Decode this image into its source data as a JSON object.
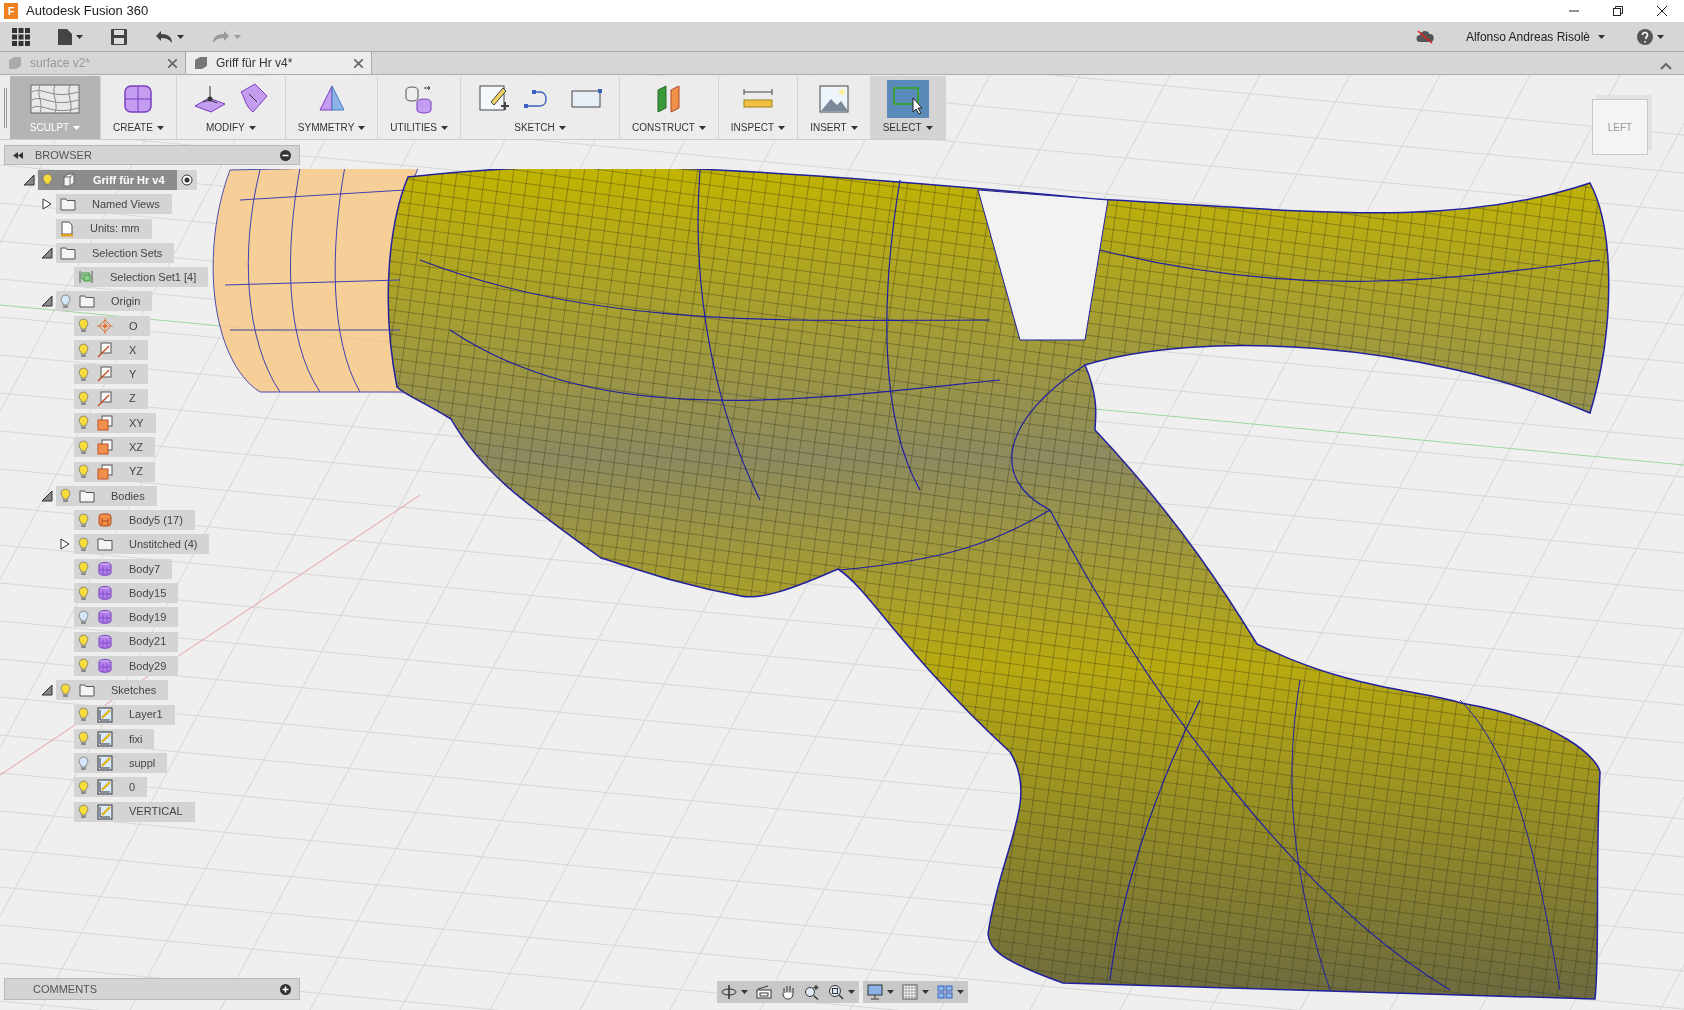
{
  "window": {
    "title": "Autodesk Fusion 360",
    "logo_letter": "F"
  },
  "user": {
    "name": "Alfonso Andreas Risolè"
  },
  "tabs": [
    {
      "label": "surface v2*",
      "selected": false
    },
    {
      "label": "Griff für Hr v4*",
      "selected": true
    }
  ],
  "toolbar": [
    {
      "kind": "sculpt",
      "label": "SCULPT",
      "highlighted": false
    },
    {
      "kind": "create",
      "label": "CREATE",
      "highlighted": false
    },
    {
      "kind": "modify",
      "label": "MODIFY",
      "highlighted": false
    },
    {
      "kind": "symmetry",
      "label": "SYMMETRY",
      "highlighted": false
    },
    {
      "kind": "utilities",
      "label": "UTILITIES",
      "highlighted": false
    },
    {
      "kind": "sketch",
      "label": "SKETCH",
      "highlighted": false
    },
    {
      "kind": "construct",
      "label": "CONSTRUCT",
      "highlighted": false
    },
    {
      "kind": "inspect",
      "label": "INSPECT",
      "highlighted": false
    },
    {
      "kind": "insert",
      "label": "INSERT",
      "highlighted": false
    },
    {
      "kind": "select",
      "label": "SELECT",
      "highlighted": true
    }
  ],
  "browser": {
    "title": "BROWSER",
    "tree": [
      {
        "kind": "component",
        "label": "Griff für Hr v4",
        "visible": true,
        "expanded": true,
        "children": [
          {
            "kind": "folder",
            "label": "Named Views",
            "expanded": false
          },
          {
            "kind": "units",
            "label": "Units: mm"
          },
          {
            "kind": "folder",
            "label": "Selection Sets",
            "expanded": true,
            "children": [
              {
                "kind": "selection-set",
                "label": "Selection Set1 [4]"
              }
            ]
          },
          {
            "kind": "folder",
            "label": "Origin",
            "visible": false,
            "expanded": true,
            "children": [
              {
                "kind": "point",
                "label": "O",
                "visible": true
              },
              {
                "kind": "axis",
                "label": "X",
                "visible": true
              },
              {
                "kind": "axis",
                "label": "Y",
                "visible": true
              },
              {
                "kind": "axis",
                "label": "Z",
                "visible": true
              },
              {
                "kind": "plane",
                "label": "XY",
                "visible": true
              },
              {
                "kind": "plane",
                "label": "XZ",
                "visible": true
              },
              {
                "kind": "plane",
                "label": "YZ",
                "visible": true
              }
            ]
          },
          {
            "kind": "folder",
            "label": "Bodies",
            "visible": true,
            "expanded": true,
            "children": [
              {
                "kind": "brep",
                "label": "Body5 (17)",
                "visible": true
              },
              {
                "kind": "folder",
                "label": "Unstitched (4)",
                "visible": true,
                "expanded": false
              },
              {
                "kind": "tsurface",
                "label": "Body7",
                "visible": true
              },
              {
                "kind": "tsurface",
                "label": "Body15",
                "visible": true
              },
              {
                "kind": "tsurface",
                "label": "Body19",
                "visible": false
              },
              {
                "kind": "tsurface",
                "label": "Body21",
                "visible": true
              },
              {
                "kind": "tsurface",
                "label": "Body29",
                "visible": true
              }
            ]
          },
          {
            "kind": "folder",
            "label": "Sketches",
            "visible": true,
            "expanded": true,
            "children": [
              {
                "kind": "sketch",
                "label": "Layer1",
                "visible": true
              },
              {
                "kind": "sketch",
                "label": "fixi",
                "visible": true
              },
              {
                "kind": "sketch",
                "label": "suppl",
                "visible": false
              },
              {
                "kind": "sketch",
                "label": "0",
                "visible": true
              },
              {
                "kind": "sketch",
                "label": "VERTICAL",
                "visible": true
              }
            ]
          }
        ]
      }
    ]
  },
  "comments": {
    "title": "COMMENTS"
  },
  "viewcube": {
    "face": "LEFT"
  }
}
